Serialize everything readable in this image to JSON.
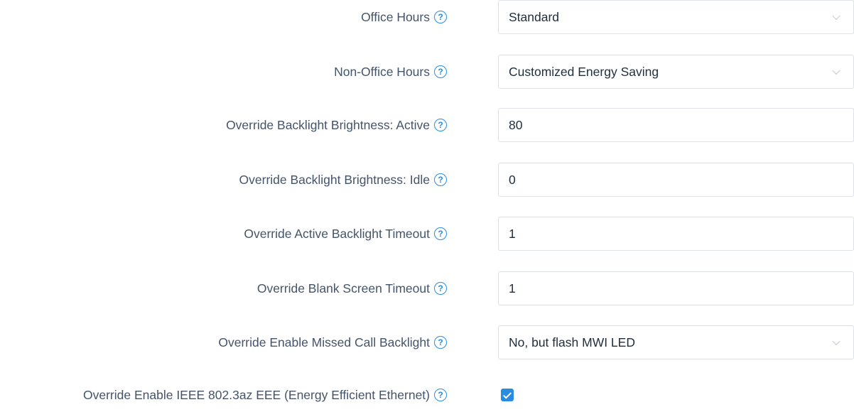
{
  "settings": {
    "office_hours": {
      "label": "Office Hours",
      "value": "Standard"
    },
    "non_office_hours": {
      "label": "Non-Office Hours",
      "value": "Customized Energy Saving"
    },
    "backlight_active": {
      "label": "Override Backlight Brightness: Active",
      "value": "80"
    },
    "backlight_idle": {
      "label": "Override Backlight Brightness: Idle",
      "value": "0"
    },
    "active_backlight_timeout": {
      "label": "Override Active Backlight Timeout",
      "value": "1"
    },
    "blank_screen_timeout": {
      "label": "Override Blank Screen Timeout",
      "value": "1"
    },
    "missed_call_backlight": {
      "label": "Override Enable Missed Call Backlight",
      "value": "No, but flash MWI LED"
    },
    "ieee_eee": {
      "label": "Override Enable IEEE 802.3az EEE (Energy Efficient Ethernet)",
      "checked": true
    }
  },
  "icons": {
    "help": "?"
  },
  "colors": {
    "accent": "#2a8ce0",
    "label_text": "#44546a",
    "value_text": "#1f2d3d",
    "border": "#dcdfe6"
  }
}
